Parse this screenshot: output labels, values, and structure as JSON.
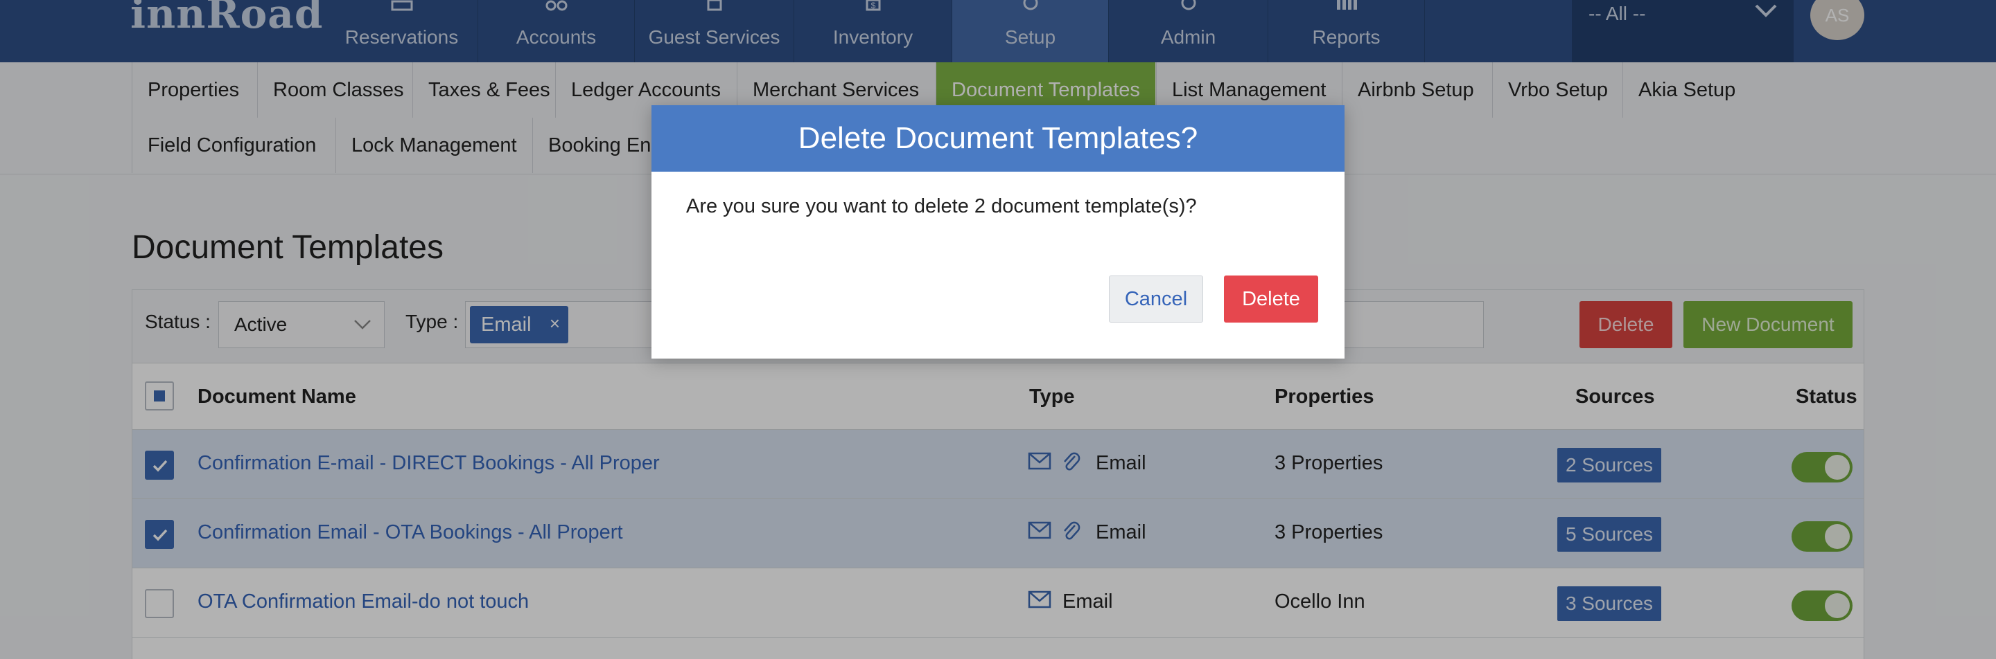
{
  "app": {
    "logo_text": "innRoad"
  },
  "topnav": {
    "items": [
      {
        "label": "Reservations",
        "icon": "reservations-icon"
      },
      {
        "label": "Accounts",
        "icon": "accounts-icon"
      },
      {
        "label": "Guest Services",
        "icon": "guest-services-icon"
      },
      {
        "label": "Inventory",
        "icon": "inventory-icon"
      },
      {
        "label": "Setup",
        "icon": "setup-icon",
        "active": true
      },
      {
        "label": "Admin",
        "icon": "admin-icon"
      },
      {
        "label": "Reports",
        "icon": "reports-icon"
      }
    ],
    "property_selector": "-- All --",
    "avatar_initials": "AS"
  },
  "subnav": {
    "items": [
      "Properties",
      "Room Classes",
      "Taxes & Fees",
      "Ledger Accounts",
      "Merchant Services",
      "Document Templates",
      "List Management",
      "Airbnb Setup",
      "Vrbo Setup",
      "Akia Setup",
      "Field Configuration",
      "Lock Management",
      "Booking En"
    ],
    "active_index": 5
  },
  "page": {
    "title": "Document Templates",
    "filters": {
      "status_label": "Status :",
      "status_value": "Active",
      "type_label": "Type :",
      "type_tag": "Email",
      "tag_remove": "×"
    },
    "buttons": {
      "delete": "Delete",
      "new_document": "New Document"
    },
    "table": {
      "headers": {
        "name": "Document Name",
        "type": "Type",
        "properties": "Properties",
        "sources": "Sources",
        "status": "Status"
      },
      "rows": [
        {
          "name": "Confirmation E-mail - DIRECT Bookings - All Proper",
          "type": "Email",
          "attachment": true,
          "properties": "3 Properties",
          "sources": "2 Sources",
          "checked": true,
          "status_on": true
        },
        {
          "name": "Confirmation Email - OTA Bookings - All Propert",
          "type": "Email",
          "attachment": true,
          "properties": "3 Properties",
          "sources": "5 Sources",
          "checked": true,
          "status_on": true
        },
        {
          "name": "OTA Confirmation Email-do not touch",
          "type": "Email",
          "attachment": false,
          "properties": "Ocello Inn",
          "sources": "3 Sources",
          "checked": false,
          "status_on": true
        }
      ]
    }
  },
  "modal": {
    "title": "Delete Document Templates?",
    "message": "Are you sure you want to delete 2 document template(s)?",
    "cancel_label": "Cancel",
    "delete_label": "Delete"
  },
  "colors": {
    "nav_bg": "#2e4f87",
    "accent_green": "#7fb346",
    "primary_blue": "#3b67b1",
    "danger_red": "#e6474e",
    "modal_header": "#4a7bc4"
  }
}
